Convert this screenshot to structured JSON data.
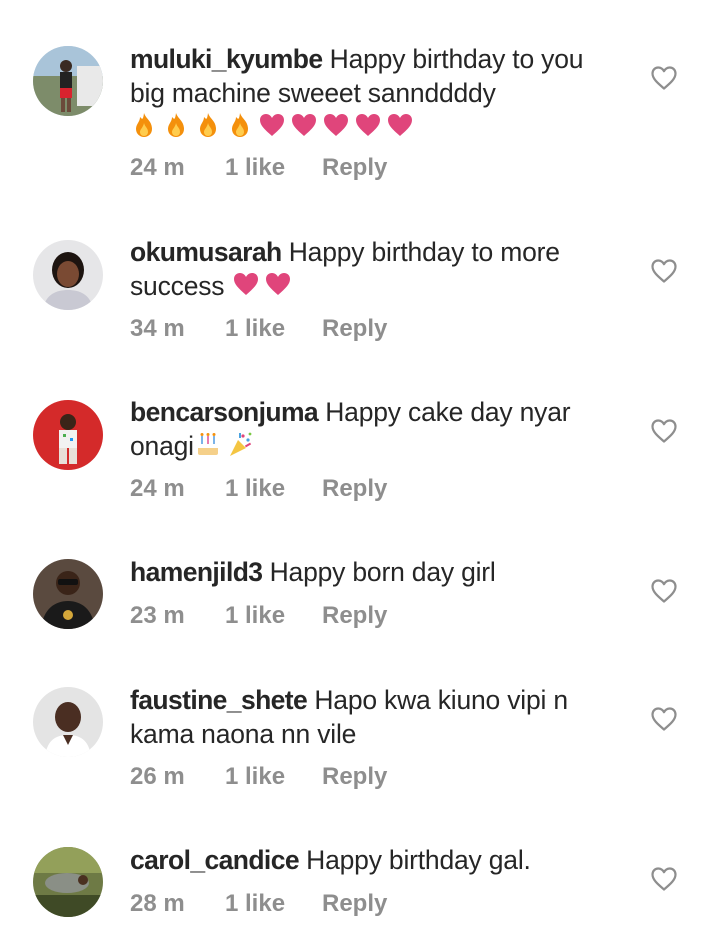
{
  "comments": [
    {
      "username": "muluki_kyumbe",
      "text": "Happy birthday to you big machine sweeet sannddddy",
      "emojis": [
        "fire",
        "fire",
        "fire",
        "fire",
        "heart",
        "heart",
        "heart",
        "heart",
        "heart"
      ],
      "time": "24 m",
      "likes": "1 like",
      "reply": "Reply"
    },
    {
      "username": "okumusarah",
      "text": "Happy birthday to more success",
      "emojis": [
        "heart",
        "heart"
      ],
      "time": "34 m",
      "likes": "1 like",
      "reply": "Reply"
    },
    {
      "username": "bencarsonjuma",
      "text": "Happy cake day nyar onagi",
      "emojis": [
        "birthday-cake",
        "party-popper"
      ],
      "time": "24 m",
      "likes": "1 like",
      "reply": "Reply"
    },
    {
      "username": "hamenjild3",
      "text": "Happy born day girl",
      "emojis": [],
      "time": "23 m",
      "likes": "1 like",
      "reply": "Reply"
    },
    {
      "username": "faustine_shete",
      "text": "Hapo kwa kiuno vipi n kama naona nn vile",
      "emojis": [],
      "time": "26 m",
      "likes": "1 like",
      "reply": "Reply"
    },
    {
      "username": "carol_candice",
      "text": "Happy birthday gal.",
      "emojis": [],
      "time": "28 m",
      "likes": "1 like",
      "reply": "Reply"
    }
  ],
  "colors": {
    "text": "#262626",
    "meta": "#8e8e8e",
    "heart_emoji": "#e0457b",
    "fire_emoji": "#f4900c",
    "like_icon": "#8e8e8e"
  }
}
